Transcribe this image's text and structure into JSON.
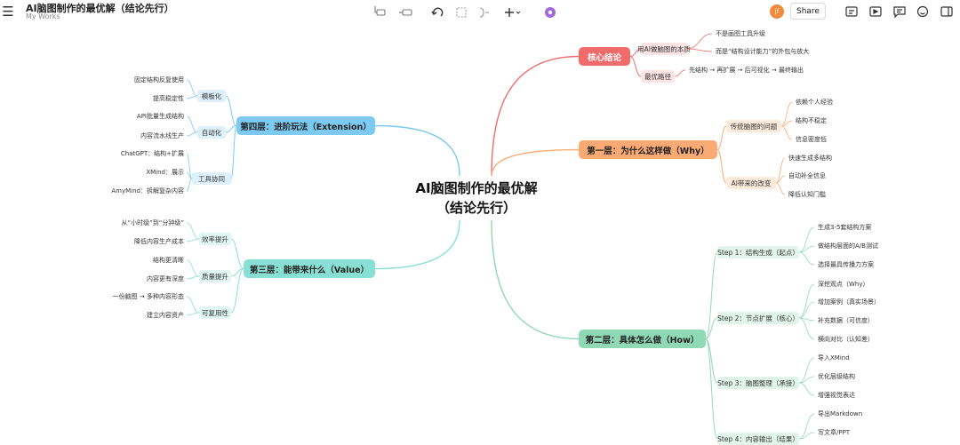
{
  "app": {
    "title": "AI脑图制作的最优解（结论先行）",
    "subtitle": "My Works",
    "avatar_initials": "jf",
    "share_label": "Share"
  },
  "icons": {
    "menu": "hamburger-menu-icon",
    "toolbar_center": [
      "subtopic-icon",
      "topic-icon",
      "undo-icon",
      "boundary-icon",
      "summary-icon",
      "insert-plus-icon",
      "theme-flower-icon"
    ],
    "toolbar_right": [
      "outline-icon",
      "pitch-icon",
      "comment-icon",
      "emoji-icon",
      "panel-icon"
    ]
  },
  "colors": {
    "core": "#f26b6b",
    "why": "#fbaa73",
    "how": "#8fd9b6",
    "value": "#88e0d4",
    "ext": "#7ccaf2",
    "avatar": "#f08a3c"
  },
  "mindmap": {
    "root": {
      "line1": "AI脑图制作的最优解",
      "line2": "（结论先行）"
    },
    "core": {
      "label": "核心结论",
      "children": [
        {
          "label": "用AI做脑图的本质",
          "leaves": [
            "不是画图工具升级",
            "而是“结构设计能力”的外包与放大"
          ]
        },
        {
          "label": "最优路径",
          "leaves": [
            "先结构 → 再扩展 → 后可视化 → 最终输出"
          ]
        }
      ]
    },
    "why": {
      "label": "第一层：为什么这样做（Why）",
      "children": [
        {
          "label": "传统脑图的问题",
          "leaves": [
            "依赖个人经验",
            "结构不稳定",
            "信息密度低"
          ]
        },
        {
          "label": "AI带来的改变",
          "leaves": [
            "快速生成多结构",
            "自动补全信息",
            "降低认知门槛"
          ]
        }
      ]
    },
    "how": {
      "label": "第二层：具体怎么做（How）",
      "children": [
        {
          "label": "Step 1：结构生成（起点）",
          "leaves": [
            "生成3-5套结构方案",
            "做结构层面的A/B测试",
            "选择最具传播力方案"
          ]
        },
        {
          "label": "Step 2：节点扩展（核心）",
          "leaves": [
            "深挖观点（Why）",
            "增加案例（真实场景）",
            "补充数据（可信度）",
            "横向对比（认知差）"
          ]
        },
        {
          "label": "Step 3：脑图整理（承接）",
          "leaves": [
            "导入XMind",
            "优化层级结构",
            "增强视觉表达"
          ]
        },
        {
          "label": "Step 4：内容输出（结果）",
          "leaves": [
            "导出Markdown",
            "写文章/PPT"
          ]
        }
      ]
    },
    "value": {
      "label": "第三层：能带来什么（Value）",
      "children": [
        {
          "label": "效率提升",
          "leaves": [
            "从“小时级”到“分钟级”",
            "降低内容生产成本"
          ]
        },
        {
          "label": "质量提升",
          "leaves": [
            "结构更清晰",
            "内容更有深度"
          ]
        },
        {
          "label": "可复用性",
          "leaves": [
            "一份脑图 → 多种内容形态",
            "建立内容资产"
          ]
        }
      ]
    },
    "ext": {
      "label": "第四层：进阶玩法（Extension）",
      "children": [
        {
          "label": "模板化",
          "leaves": [
            "固定结构反复使用",
            "提高稳定性"
          ]
        },
        {
          "label": "自动化",
          "leaves": [
            "API批量生成结构",
            "内容流水线生产"
          ]
        },
        {
          "label": "工具协同",
          "leaves": [
            "ChatGPT：结构+扩展",
            "XMind：展示",
            "AmyMind：拆解复杂内容"
          ]
        }
      ]
    }
  }
}
